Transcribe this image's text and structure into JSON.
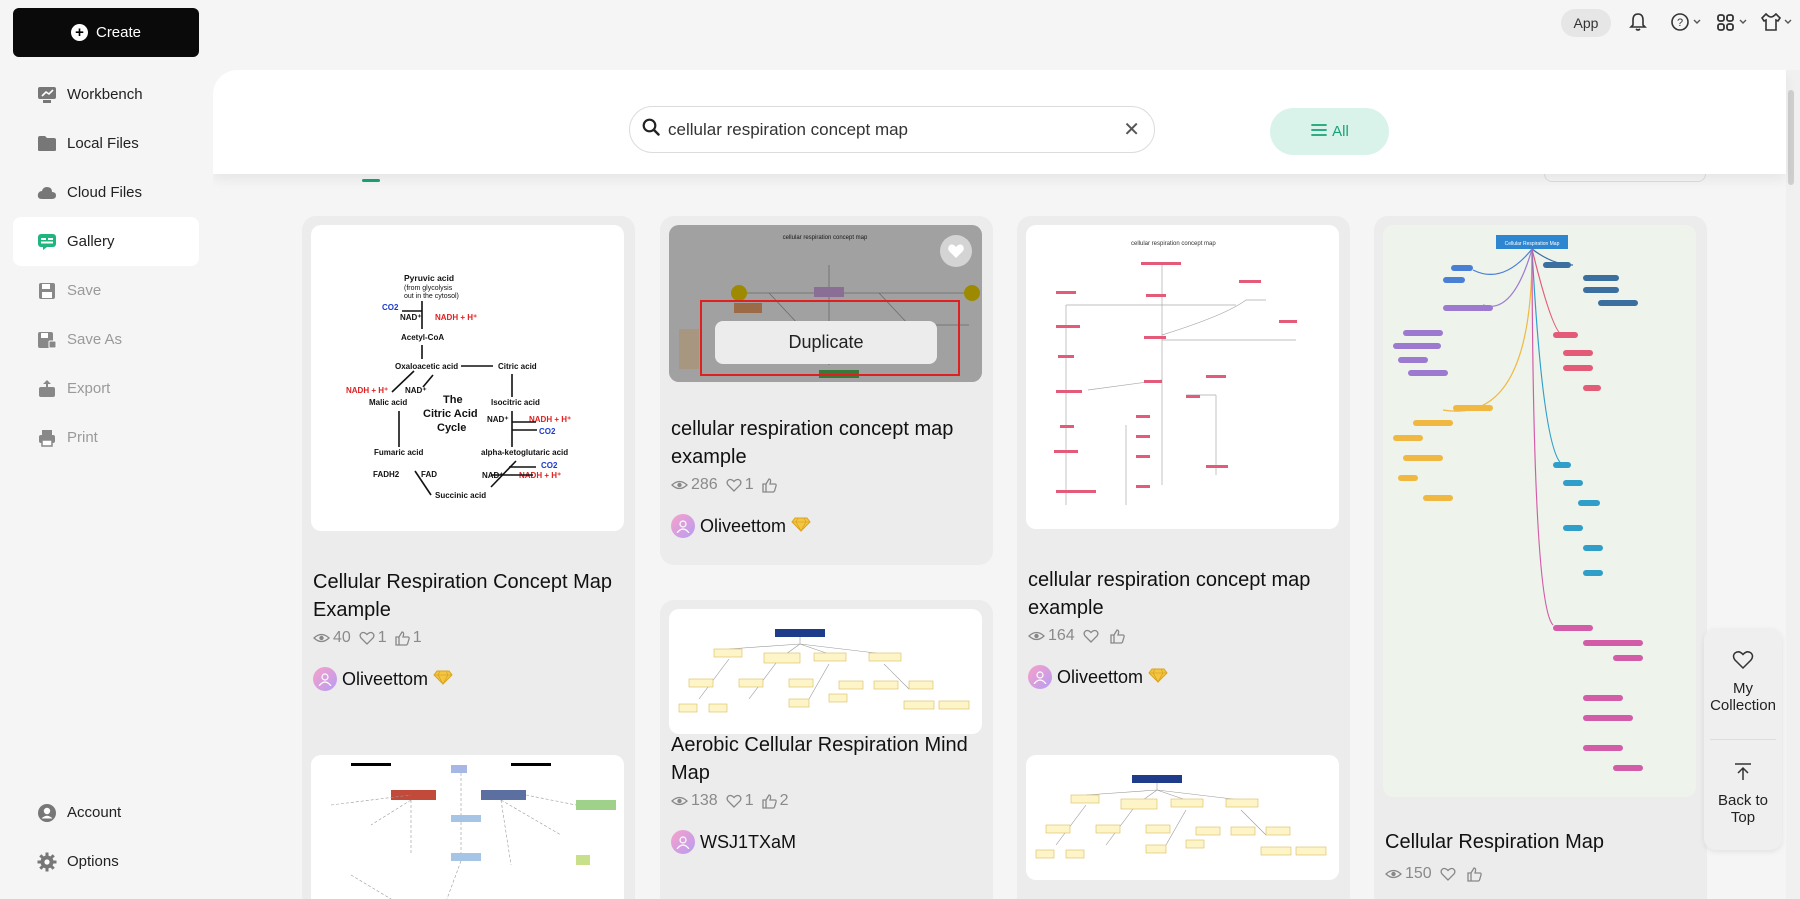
{
  "sidebar": {
    "create_label": "Create",
    "items": [
      {
        "label": "Workbench",
        "icon": "workbench-icon"
      },
      {
        "label": "Local Files",
        "icon": "folder-icon"
      },
      {
        "label": "Cloud Files",
        "icon": "cloud-icon"
      },
      {
        "label": "Gallery",
        "icon": "gallery-icon"
      },
      {
        "label": "Save",
        "icon": "save-icon"
      },
      {
        "label": "Save As",
        "icon": "save-as-icon"
      },
      {
        "label": "Export",
        "icon": "export-icon"
      },
      {
        "label": "Print",
        "icon": "print-icon"
      }
    ],
    "bottom": [
      {
        "label": "Account",
        "icon": "account-icon"
      },
      {
        "label": "Options",
        "icon": "gear-icon"
      }
    ]
  },
  "topbar": {
    "app_label": "App"
  },
  "search": {
    "value": "cellular respiration concept map",
    "filter_label": "All"
  },
  "cards": [
    {
      "title": "Cellular Respiration Concept Map Example",
      "views": "40",
      "likes": "1",
      "thumbs": "1",
      "author": "Oliveettom"
    },
    {
      "title": "cellular respiration concept map example",
      "views": "286",
      "likes": "1",
      "thumbs": "",
      "author": "Oliveettom",
      "overlay_action": "Duplicate"
    },
    {
      "title": "cellular respiration concept map example",
      "views": "164",
      "likes": "",
      "thumbs": "",
      "author": "Oliveettom"
    },
    {
      "title": "Cellular Respiration Map",
      "views": "150",
      "likes": "",
      "thumbs": ""
    },
    {
      "title": "Aerobic Cellular Respiration Mind Map",
      "views": "138",
      "likes": "1",
      "thumbs": "2",
      "author": "WSJ1TXaM"
    }
  ],
  "thumb_text": {
    "citric": [
      "Pyruvic acid",
      "(from glycolysis",
      "out in the cytosol)",
      "CO2",
      "NAD⁺",
      "NADH + H⁺",
      "Acetyl-CoA",
      "Oxaloacetic acid",
      "Citric acid",
      "NADH + H⁺",
      "NAD⁺",
      "The",
      "Citric Acid",
      "Cycle",
      "Malic acid",
      "Isocitric acid",
      "NAD⁺",
      "NADH + H⁺",
      "CO2",
      "Fumaric acid",
      "alpha-ketoglutaric acid",
      "FADH2",
      "FAD",
      "NAD⁺",
      "CO2",
      "NADH + H⁺",
      "Succinic acid"
    ],
    "grey_title": "cellular respiration concept map",
    "pink_title": "cellular respiration concept map",
    "mind_title": "Cellular Respiration Map"
  },
  "float": {
    "collection_label_1": "My",
    "collection_label_2": "Collection",
    "top_label_1": "Back to",
    "top_label_2": "Top"
  },
  "colors": {
    "accent": "#18a277",
    "accent_bg": "#d9f3ea",
    "highlight": "#e02020",
    "badge": "#f5c542"
  }
}
